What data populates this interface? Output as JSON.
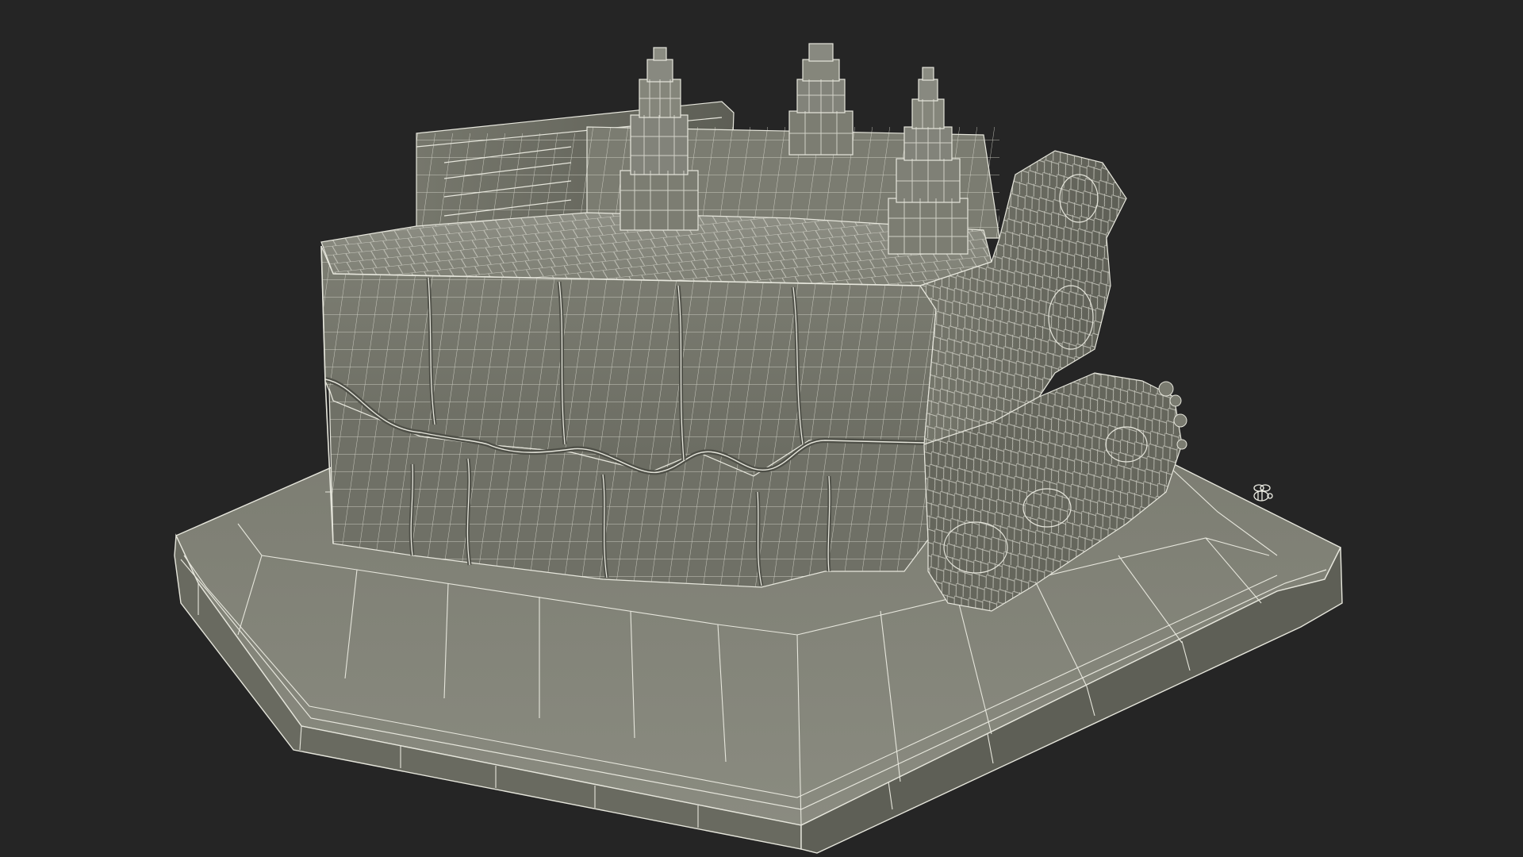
{
  "scene": {
    "background": "#252525",
    "subject": "wireframe-rock-diorama",
    "mesh_fill": "#7a7b70",
    "mesh_fill_dark": "#5f6057",
    "mesh_fill_light": "#8c8d82",
    "wire_color": "#e6e6dc",
    "base_top": "#85867b",
    "base_side": "#6b6c62",
    "spire_count": 3,
    "signature_icon": "bee-logo-icon"
  }
}
